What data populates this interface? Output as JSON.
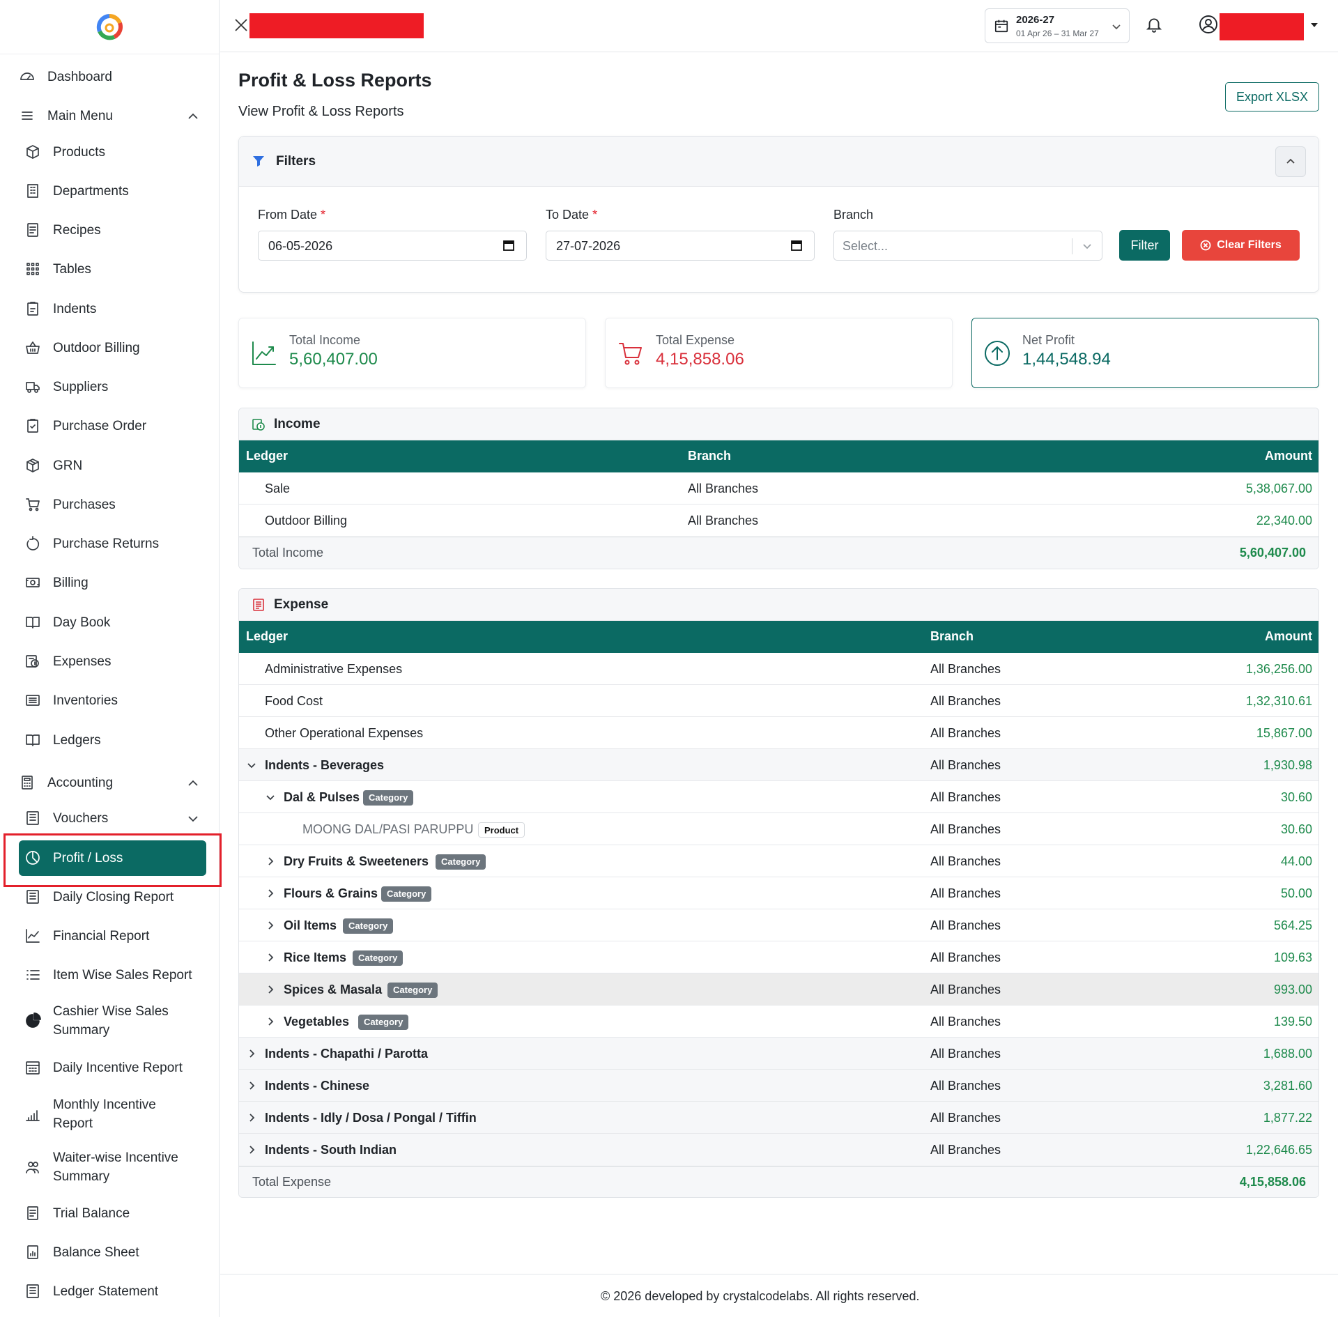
{
  "sidebar": {
    "items": [
      {
        "label": "Dashboard",
        "icon": "gauge-icon"
      },
      {
        "label": "Main Menu",
        "icon": "menu-icon"
      },
      {
        "label": "Products",
        "icon": "box-icon"
      },
      {
        "label": "Departments",
        "icon": "building-icon"
      },
      {
        "label": "Recipes",
        "icon": "recipe-icon"
      },
      {
        "label": "Tables",
        "icon": "grid-icon"
      },
      {
        "label": "Indents",
        "icon": "clipboard-icon"
      },
      {
        "label": "Outdoor Billing",
        "icon": "basket-icon"
      },
      {
        "label": "Suppliers",
        "icon": "truck-icon"
      },
      {
        "label": "Purchase Order",
        "icon": "clipboard-check-icon"
      },
      {
        "label": "GRN",
        "icon": "package-icon"
      },
      {
        "label": "Purchases",
        "icon": "cart-icon"
      },
      {
        "label": "Purchase Returns",
        "icon": "rotate-icon"
      },
      {
        "label": "Billing",
        "icon": "cash-icon"
      },
      {
        "label": "Day Book",
        "icon": "book-icon"
      },
      {
        "label": "Expenses",
        "icon": "expense-icon"
      },
      {
        "label": "Inventories",
        "icon": "list-icon"
      },
      {
        "label": "Ledgers",
        "icon": "book-open-icon"
      },
      {
        "label": "Accounting",
        "icon": "calculator-icon"
      },
      {
        "label": "Vouchers",
        "icon": "voucher-icon"
      },
      {
        "label": "Profit / Loss",
        "icon": "pie-icon"
      },
      {
        "label": "Daily Closing Report",
        "icon": "report-icon"
      },
      {
        "label": "Financial Report",
        "icon": "chart-line-icon"
      },
      {
        "label": "Item Wise Sales Report",
        "icon": "list-numbered-icon"
      },
      {
        "label": "Cashier Wise Sales",
        "label2": "Summary",
        "icon": "pie-solid-icon"
      },
      {
        "label": "Daily Incentive Report",
        "icon": "calendar-grid-icon"
      },
      {
        "label": "Monthly Incentive",
        "label2": "Report",
        "icon": "bar-chart-icon"
      },
      {
        "label": "Waiter-wise Incentive",
        "label2": "Summary",
        "icon": "users-icon"
      },
      {
        "label": "Trial Balance",
        "icon": "document-icon"
      },
      {
        "label": "Balance Sheet",
        "icon": "balance-icon"
      },
      {
        "label": "Ledger Statement",
        "icon": "statement-icon"
      }
    ]
  },
  "topbar": {
    "fy_year": "2026-27",
    "fy_range": "01 Apr 26 – 31 Mar 27"
  },
  "page": {
    "title": "Profit & Loss Reports",
    "subtitle": "View Profit & Loss Reports",
    "export_label": "Export XLSX"
  },
  "filters": {
    "title": "Filters",
    "from_label": "From Date",
    "from_value": "06-05-2026",
    "to_label": "To Date",
    "to_value": "27-07-2026",
    "branch_label": "Branch",
    "branch_placeholder": "Select...",
    "required_mark": "*",
    "filter_button": "Filter",
    "clear_button": "Clear Filters"
  },
  "stats": {
    "income_label": "Total Income",
    "income_value": "5,60,407.00",
    "expense_label": "Total Expense",
    "expense_value": "4,15,858.06",
    "profit_label": "Net Profit",
    "profit_value": "1,44,548.94",
    "colors": {
      "income": "#1e8a4c",
      "expense": "#d9303b",
      "profit": "#0b6a63"
    }
  },
  "income": {
    "title": "Income",
    "col_ledger": "Ledger",
    "col_branch": "Branch",
    "col_amount": "Amount",
    "rows": [
      {
        "ledger": "Sale",
        "branch": "All Branches",
        "amount": "5,38,067.00"
      },
      {
        "ledger": "Outdoor Billing",
        "branch": "All Branches",
        "amount": "22,340.00"
      }
    ],
    "total_label": "Total Income",
    "total_value": "5,60,407.00"
  },
  "expense": {
    "title": "Expense",
    "col_ledger": "Ledger",
    "col_branch": "Branch",
    "col_amount": "Amount",
    "rows": [
      {
        "ledger": "Administrative Expenses",
        "branch": "All Branches",
        "amount": "1,36,256.00"
      },
      {
        "ledger": "Food Cost",
        "branch": "All Branches",
        "amount": "1,32,310.61"
      },
      {
        "ledger": "Other Operational Expenses",
        "branch": "All Branches",
        "amount": "15,867.00"
      },
      {
        "ledger": "Indents - Beverages",
        "branch": "All Branches",
        "amount": "1,930.98"
      },
      {
        "ledger": "Dal & Pulses",
        "badge": "Category",
        "branch": "All Branches",
        "amount": "30.60"
      },
      {
        "ledger": "MOONG DAL/PASI PARUPPU",
        "badge": "Product",
        "branch": "All Branches",
        "amount": "30.60"
      },
      {
        "ledger": "Dry Fruits & Sweeteners",
        "badge": "Category",
        "branch": "All Branches",
        "amount": "44.00"
      },
      {
        "ledger": "Flours & Grains",
        "badge": "Category",
        "branch": "All Branches",
        "amount": "50.00"
      },
      {
        "ledger": "Oil Items",
        "badge": "Category",
        "branch": "All Branches",
        "amount": "564.25"
      },
      {
        "ledger": "Rice Items",
        "badge": "Category",
        "branch": "All Branches",
        "amount": "109.63"
      },
      {
        "ledger": "Spices & Masala",
        "badge": "Category",
        "branch": "All Branches",
        "amount": "993.00"
      },
      {
        "ledger": "Vegetables",
        "badge": "Category",
        "branch": "All Branches",
        "amount": "139.50"
      },
      {
        "ledger": "Indents - Chapathi / Parotta",
        "branch": "All Branches",
        "amount": "1,688.00"
      },
      {
        "ledger": "Indents - Chinese",
        "branch": "All Branches",
        "amount": "3,281.60"
      },
      {
        "ledger": "Indents - Idly / Dosa / Pongal / Tiffin",
        "branch": "All Branches",
        "amount": "1,877.22"
      },
      {
        "ledger": "Indents - South Indian",
        "branch": "All Branches",
        "amount": "1,22,646.65"
      }
    ],
    "total_label": "Total Expense",
    "total_value": "4,15,858.06"
  },
  "footer": {
    "text": "© 2026 developed by crystalcodelabs. All rights reserved."
  }
}
